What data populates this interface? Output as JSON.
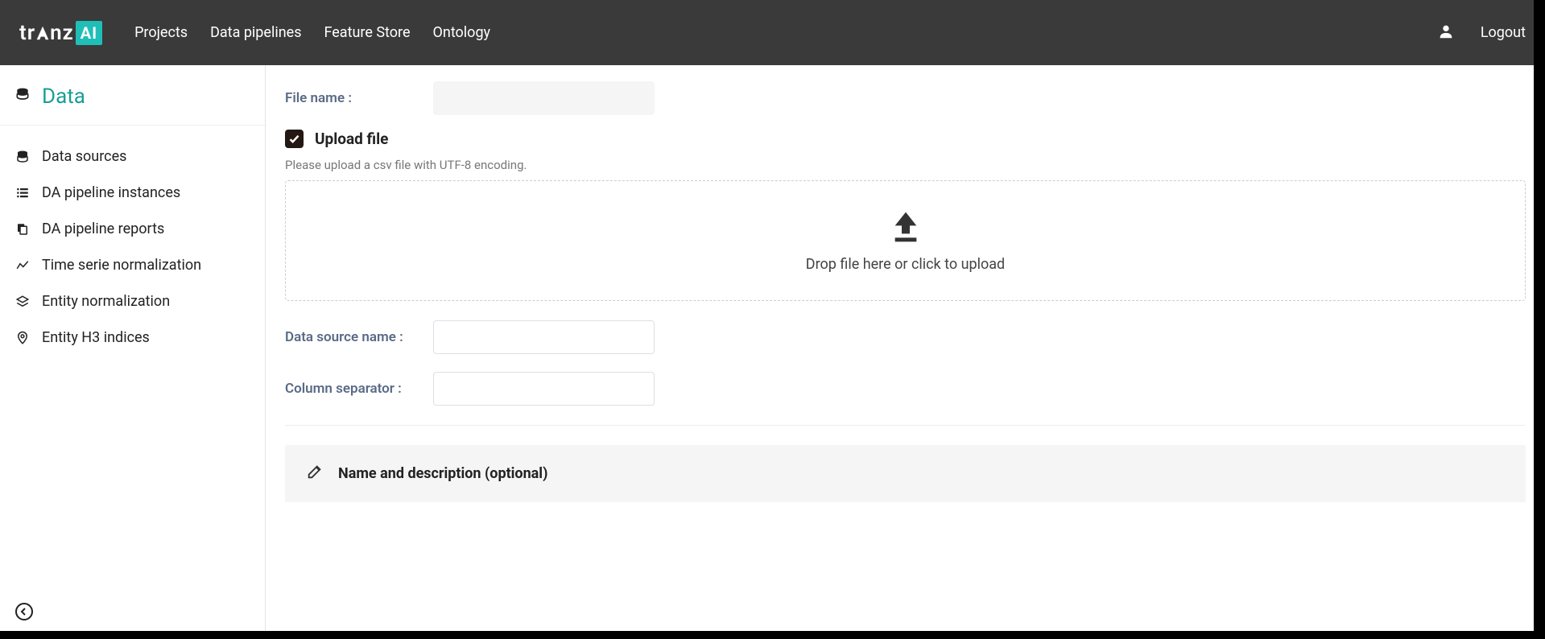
{
  "brand": {
    "name_pre": "tr",
    "name_mid": "nz",
    "name_ai": "AI"
  },
  "topnav": {
    "items": [
      {
        "label": "Projects"
      },
      {
        "label": "Data pipelines"
      },
      {
        "label": "Feature Store"
      },
      {
        "label": "Ontology"
      }
    ],
    "logout": "Logout"
  },
  "sidebar": {
    "title": "Data",
    "items": [
      {
        "icon": "stack",
        "label": "Data sources"
      },
      {
        "icon": "list",
        "label": "DA pipeline instances"
      },
      {
        "icon": "copy",
        "label": "DA pipeline reports"
      },
      {
        "icon": "chart",
        "label": "Time serie normalization"
      },
      {
        "icon": "layers",
        "label": "Entity normalization"
      },
      {
        "icon": "pin",
        "label": "Entity H3 indices"
      }
    ]
  },
  "form": {
    "file_name_label": "File name :",
    "file_name_value": "",
    "upload_section_title": "Upload file",
    "upload_note": "Please upload a csv file with UTF-8 encoding.",
    "dropzone_text": "Drop file here or click to upload",
    "data_source_name_label": "Data source name :",
    "data_source_name_value": "",
    "column_separator_label": "Column separator :",
    "column_separator_value": "",
    "name_desc_section_title": "Name and description (optional)"
  }
}
